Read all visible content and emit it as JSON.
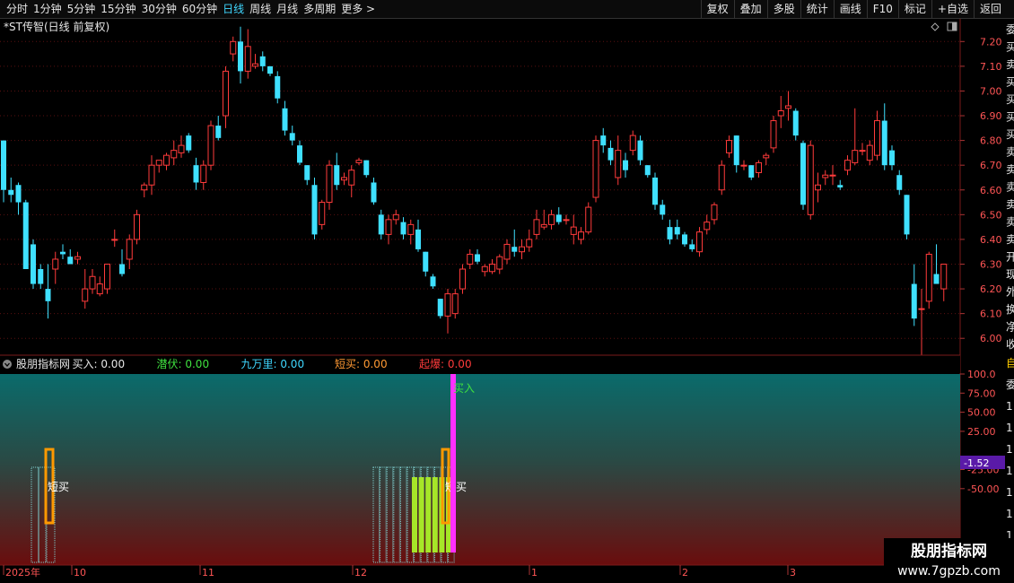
{
  "toolbar": {
    "tabs": [
      "分时",
      "1分钟",
      "5分钟",
      "15分钟",
      "30分钟",
      "60分钟",
      "日线",
      "周线",
      "月线",
      "多周期",
      "更多 >"
    ],
    "active_tab": "日线",
    "tools": [
      "复权",
      "叠加",
      "多股",
      "统计",
      "画线",
      "F10",
      "标记",
      "+自选",
      "返回"
    ]
  },
  "main_title": "*ST传智(日线 前复权)",
  "indicator_header": [
    {
      "text": "股朋指标网",
      "color": "#e6e6e6"
    },
    {
      "text": "买入: 0.00",
      "color": "#e6e6e6"
    },
    {
      "text": "潜伏: 0.00",
      "color": "#3fe03f"
    },
    {
      "text": "九万里: 0.00",
      "color": "#3fd7ff"
    },
    {
      "text": "短买: 0.00",
      "color": "#ff9933"
    },
    {
      "text": "起爆: 0.00",
      "color": "#ff3b3b"
    }
  ],
  "price_axis": [
    "7.20",
    "7.10",
    "7.00",
    "6.90",
    "6.80",
    "6.70",
    "6.60",
    "6.50",
    "6.40",
    "6.30",
    "6.20",
    "6.10",
    "6.00"
  ],
  "indicator_axis": [
    "100.0",
    "75.00",
    "50.00",
    "25.00",
    "-25.00",
    "-50.00"
  ],
  "current_value": "-1.52",
  "date_axis": [
    "2025年",
    "10",
    "11",
    "12",
    "1",
    "2",
    "3"
  ],
  "annotations": {
    "short_buy": "短买",
    "buy": "买入"
  },
  "right_strip_chars": [
    "委",
    "买",
    "卖",
    "买",
    "买",
    "买",
    "买",
    "卖",
    "卖",
    "卖",
    "卖",
    "卖",
    "卖",
    "开",
    "现",
    "外",
    "换",
    "净",
    "收"
  ],
  "right_strip_bottom": [
    "自",
    "委",
    "1",
    "1",
    "1",
    "1",
    "1",
    "1",
    "1"
  ],
  "watermark": {
    "line1": "股朋指标网",
    "line2": "www.7gpzb.com"
  },
  "colors": {
    "up": "#ff3b3b",
    "down": "#3fe0ff",
    "buy_bar": "#ff2fff",
    "short_bar": "#ff9900",
    "green_bar": "#a6e628"
  },
  "chart_data": {
    "type": "candlestick",
    "ylim": [
      5.95,
      7.27
    ],
    "candles": [
      [
        6.8,
        6.8,
        6.55,
        6.6
      ],
      [
        6.6,
        6.65,
        6.55,
        6.58
      ],
      [
        6.62,
        6.63,
        6.5,
        6.55
      ],
      [
        6.55,
        6.56,
        6.28,
        6.28
      ],
      [
        6.38,
        6.4,
        6.2,
        6.22
      ],
      [
        6.28,
        6.3,
        6.2,
        6.22
      ],
      [
        6.2,
        6.3,
        6.08,
        6.15
      ],
      [
        6.28,
        6.35,
        6.22,
        6.32
      ],
      [
        6.35,
        6.38,
        6.32,
        6.34
      ],
      [
        6.33,
        6.36,
        6.3,
        6.3
      ],
      [
        6.32,
        6.35,
        6.3,
        6.33
      ],
      [
        6.15,
        6.28,
        6.12,
        6.2
      ],
      [
        6.2,
        6.28,
        6.18,
        6.25
      ],
      [
        6.18,
        6.25,
        6.17,
        6.22
      ],
      [
        6.2,
        6.3,
        6.18,
        6.3
      ],
      [
        6.4,
        6.44,
        6.37,
        6.4
      ],
      [
        6.3,
        6.36,
        6.25,
        6.26
      ],
      [
        6.32,
        6.42,
        6.28,
        6.4
      ],
      [
        6.4,
        6.52,
        6.38,
        6.5
      ],
      [
        6.6,
        6.63,
        6.57,
        6.62
      ],
      [
        6.62,
        6.74,
        6.58,
        6.7
      ],
      [
        6.7,
        6.72,
        6.67,
        6.72
      ],
      [
        6.7,
        6.75,
        6.68,
        6.74
      ],
      [
        6.73,
        6.8,
        6.7,
        6.76
      ],
      [
        6.75,
        6.82,
        6.73,
        6.78
      ],
      [
        6.82,
        6.83,
        6.75,
        6.76
      ],
      [
        6.7,
        6.73,
        6.6,
        6.63
      ],
      [
        6.63,
        6.72,
        6.6,
        6.7
      ],
      [
        6.7,
        6.88,
        6.68,
        6.86
      ],
      [
        6.86,
        6.9,
        6.8,
        6.81
      ],
      [
        6.9,
        7.1,
        6.85,
        7.08
      ],
      [
        7.15,
        7.22,
        7.12,
        7.2
      ],
      [
        7.2,
        7.26,
        7.03,
        7.08
      ],
      [
        7.08,
        7.25,
        7.05,
        7.18
      ],
      [
        7.1,
        7.15,
        7.09,
        7.11
      ],
      [
        7.14,
        7.16,
        7.08,
        7.1
      ],
      [
        7.1,
        7.1,
        7.06,
        7.07
      ],
      [
        7.06,
        7.08,
        6.95,
        6.97
      ],
      [
        6.93,
        6.96,
        6.82,
        6.84
      ],
      [
        6.83,
        6.86,
        6.78,
        6.8
      ],
      [
        6.78,
        6.8,
        6.7,
        6.71
      ],
      [
        6.7,
        6.7,
        6.62,
        6.64
      ],
      [
        6.62,
        6.65,
        6.4,
        6.42
      ],
      [
        6.46,
        6.56,
        6.44,
        6.55
      ],
      [
        6.55,
        6.72,
        6.52,
        6.7
      ],
      [
        6.7,
        6.75,
        6.6,
        6.62
      ],
      [
        6.64,
        6.67,
        6.62,
        6.65
      ],
      [
        6.62,
        6.7,
        6.57,
        6.68
      ],
      [
        6.71,
        6.73,
        6.7,
        6.72
      ],
      [
        6.72,
        6.72,
        6.65,
        6.66
      ],
      [
        6.63,
        6.65,
        6.54,
        6.55
      ],
      [
        6.5,
        6.52,
        6.4,
        6.42
      ],
      [
        6.42,
        6.5,
        6.38,
        6.48
      ],
      [
        6.48,
        6.52,
        6.46,
        6.5
      ],
      [
        6.47,
        6.49,
        6.4,
        6.42
      ],
      [
        6.42,
        6.48,
        6.38,
        6.46
      ],
      [
        6.44,
        6.48,
        6.35,
        6.36
      ],
      [
        6.35,
        6.35,
        6.25,
        6.27
      ],
      [
        6.25,
        6.26,
        6.2,
        6.21
      ],
      [
        6.16,
        6.16,
        6.08,
        6.09
      ],
      [
        6.09,
        6.2,
        6.02,
        6.18
      ],
      [
        6.1,
        6.2,
        6.08,
        6.18
      ],
      [
        6.2,
        6.3,
        6.18,
        6.28
      ],
      [
        6.3,
        6.36,
        6.28,
        6.34
      ],
      [
        6.34,
        6.36,
        6.3,
        6.31
      ],
      [
        6.27,
        6.3,
        6.25,
        6.29
      ],
      [
        6.27,
        6.32,
        6.26,
        6.3
      ],
      [
        6.28,
        6.34,
        6.26,
        6.33
      ],
      [
        6.32,
        6.4,
        6.3,
        6.38
      ],
      [
        6.37,
        6.44,
        6.33,
        6.35
      ],
      [
        6.35,
        6.4,
        6.32,
        6.37
      ],
      [
        6.37,
        6.44,
        6.35,
        6.4
      ],
      [
        6.42,
        6.52,
        6.4,
        6.48
      ],
      [
        6.45,
        6.52,
        6.44,
        6.46
      ],
      [
        6.46,
        6.52,
        6.44,
        6.5
      ],
      [
        6.5,
        6.53,
        6.46,
        6.47
      ],
      [
        6.48,
        6.5,
        6.46,
        6.48
      ],
      [
        6.42,
        6.5,
        6.38,
        6.45
      ],
      [
        6.4,
        6.45,
        6.38,
        6.43
      ],
      [
        6.43,
        6.55,
        6.42,
        6.53
      ],
      [
        6.57,
        6.82,
        6.55,
        6.8
      ],
      [
        6.82,
        6.85,
        6.75,
        6.78
      ],
      [
        6.77,
        6.8,
        6.7,
        6.72
      ],
      [
        6.65,
        6.82,
        6.62,
        6.76
      ],
      [
        6.72,
        6.75,
        6.65,
        6.68
      ],
      [
        6.76,
        6.84,
        6.74,
        6.82
      ],
      [
        6.8,
        6.82,
        6.7,
        6.72
      ],
      [
        6.7,
        6.7,
        6.65,
        6.66
      ],
      [
        6.65,
        6.67,
        6.52,
        6.54
      ],
      [
        6.54,
        6.56,
        6.48,
        6.5
      ],
      [
        6.45,
        6.48,
        6.38,
        6.4
      ],
      [
        6.45,
        6.48,
        6.4,
        6.42
      ],
      [
        6.42,
        6.43,
        6.37,
        6.38
      ],
      [
        6.38,
        6.4,
        6.35,
        6.36
      ],
      [
        6.35,
        6.45,
        6.33,
        6.43
      ],
      [
        6.44,
        6.5,
        6.42,
        6.47
      ],
      [
        6.48,
        6.55,
        6.46,
        6.54
      ],
      [
        6.6,
        6.72,
        6.58,
        6.7
      ],
      [
        6.75,
        6.82,
        6.73,
        6.8
      ],
      [
        6.82,
        6.82,
        6.67,
        6.7
      ],
      [
        6.7,
        6.72,
        6.68,
        6.7
      ],
      [
        6.7,
        6.7,
        6.64,
        6.65
      ],
      [
        6.67,
        6.72,
        6.65,
        6.71
      ],
      [
        6.73,
        6.75,
        6.7,
        6.74
      ],
      [
        6.77,
        6.9,
        6.75,
        6.88
      ],
      [
        6.9,
        6.98,
        6.85,
        6.92
      ],
      [
        6.93,
        7.0,
        6.88,
        6.94
      ],
      [
        6.92,
        6.93,
        6.8,
        6.82
      ],
      [
        6.79,
        6.8,
        6.52,
        6.54
      ],
      [
        6.5,
        6.8,
        6.48,
        6.78
      ],
      [
        6.6,
        6.67,
        6.55,
        6.62
      ],
      [
        6.65,
        6.68,
        6.62,
        6.66
      ],
      [
        6.66,
        6.7,
        6.62,
        6.66
      ],
      [
        6.62,
        6.64,
        6.6,
        6.61
      ],
      [
        6.68,
        6.74,
        6.66,
        6.72
      ],
      [
        6.71,
        6.93,
        6.7,
        6.76
      ],
      [
        6.76,
        6.79,
        6.74,
        6.76
      ],
      [
        6.72,
        6.8,
        6.7,
        6.78
      ],
      [
        6.74,
        6.92,
        6.72,
        6.88
      ],
      [
        6.88,
        6.95,
        6.68,
        6.7
      ],
      [
        6.76,
        6.78,
        6.68,
        6.7
      ],
      [
        6.66,
        6.68,
        6.58,
        6.6
      ],
      [
        6.58,
        6.58,
        6.4,
        6.42
      ],
      [
        6.22,
        6.3,
        6.05,
        6.08
      ],
      [
        6.12,
        6.2,
        5.92,
        6.12
      ],
      [
        6.15,
        6.35,
        6.12,
        6.34
      ],
      [
        6.26,
        6.38,
        6.24,
        6.22
      ],
      [
        6.2,
        6.3,
        6.15,
        6.3
      ]
    ]
  }
}
